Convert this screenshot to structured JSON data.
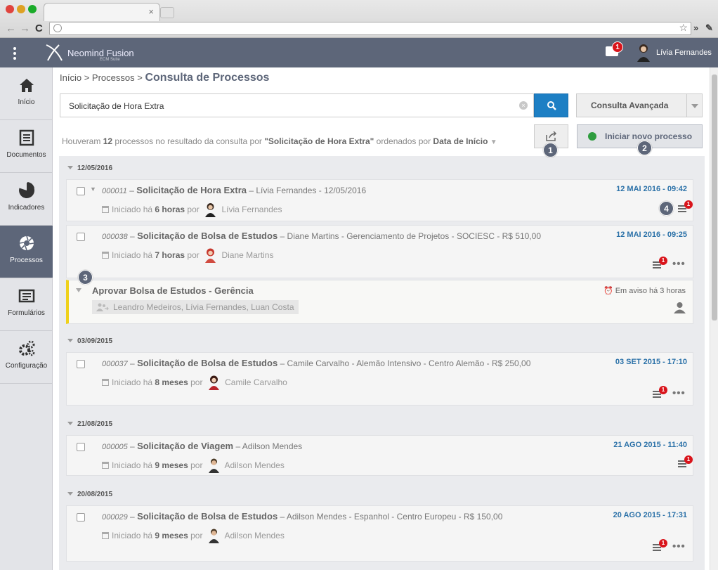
{
  "app": {
    "logo_name": "Neomind Fusion",
    "logo_sub": "ECM Suite",
    "user_name": "Lívia Fernandes",
    "notif_count": "1"
  },
  "sidebar": {
    "items": [
      {
        "label": "Início",
        "icon": "home-icon"
      },
      {
        "label": "Documentos",
        "icon": "document-icon"
      },
      {
        "label": "Indicadores",
        "icon": "pie-chart-icon"
      },
      {
        "label": "Processos",
        "icon": "aperture-icon"
      },
      {
        "label": "Formulários",
        "icon": "form-icon"
      },
      {
        "label": "Configuração",
        "icon": "gears-icon"
      }
    ]
  },
  "breadcrumb": {
    "home": "Início",
    "sep": ">",
    "processes": "Processos",
    "current": "Consulta de Processos"
  },
  "search": {
    "value": "Solicitação de Hora Extra",
    "advanced_label": "Consulta Avançada"
  },
  "result": {
    "prefix": "Houveram",
    "count": "12",
    "middle": "processos no resultado da consulta por",
    "query": "\"Solicitação de Hora Extra\"",
    "order_text": "ordenados por",
    "order_field": "Data de Início"
  },
  "new_process_label": "Iniciar novo processo",
  "callouts": [
    "1",
    "2",
    "3",
    "4"
  ],
  "groups": {
    "g1": {
      "date": "12/05/2016"
    },
    "g2": {
      "date": "03/09/2015"
    },
    "g3": {
      "date": "21/08/2015"
    },
    "g4": {
      "date": "20/08/2015"
    }
  },
  "started_label": "Iniciado há",
  "by_label": "por",
  "cards": [
    {
      "id": "000011",
      "title": "Solicitação de Hora Extra",
      "desc": "Lívia Fernandes - 12/05/2016",
      "ago": "6 horas",
      "author": "Lívia Fernandes",
      "when": "12 MAI 2016 - 09:42",
      "badge": "1"
    },
    {
      "id": "000038",
      "title": "Solicitação de Bolsa de Estudos",
      "desc": "Diane Martins - Gerenciamento de Projetos - SOCIESC - R$ 510,00",
      "ago": "7 horas",
      "author": "Diane Martins",
      "when": "12 MAI 2016 - 09:25",
      "badge": "1"
    },
    {
      "id": "000037",
      "title": "Solicitação de Bolsa de Estudos",
      "desc": "Camile Carvalho - Alemão Intensivo - Centro Alemão - R$ 250,00",
      "ago": "8 meses",
      "author": "Camile Carvalho",
      "when": "03 SET 2015 - 17:10",
      "badge": "1"
    },
    {
      "id": "000005",
      "title": "Solicitação de Viagem",
      "desc": "Adilson Mendes",
      "ago": "9 meses",
      "author": "Adilson Mendes",
      "when": "21 AGO 2015 - 11:40",
      "badge": "1"
    },
    {
      "id": "000029",
      "title": "Solicitação de Bolsa de Estudos",
      "desc": "Adilson Mendes - Espanhol - Centro Europeu - R$ 150,00",
      "ago": "9 meses",
      "author": "Adilson Mendes",
      "when": "20 AGO 2015 - 17:31",
      "badge": "1"
    }
  ],
  "subtask": {
    "title": "Aprovar Bolsa de Estudos - Gerência",
    "people": "Leandro Medeiros, Lívia Fernandes, Luan Costa",
    "warning": "Em aviso há 3 horas"
  },
  "colors": {
    "topbar": "#5d6679",
    "link": "#2b71a8",
    "badge": "#d9141b",
    "accent": "#1d7fc4",
    "warning_bar": "#efd11b"
  }
}
